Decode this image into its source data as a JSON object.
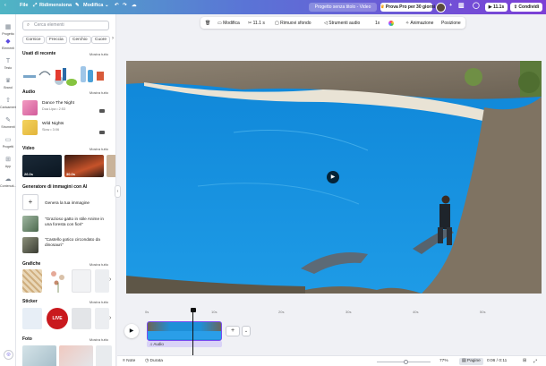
{
  "topbar": {
    "file": "File",
    "resize": "Ridimensiona",
    "edit_mode": "Modifica",
    "project_title": "Progetto senza titolo - Video",
    "trial": "Prova Pro per 30 giorni",
    "duration": "11.1s",
    "share": "Condividi"
  },
  "rail": [
    {
      "label": "Progetto",
      "icon": "layout-icon",
      "color": "#7b8591"
    },
    {
      "label": "Elementi",
      "icon": "shapes-icon",
      "color": "#5b4be0"
    },
    {
      "label": "Testo",
      "icon": "text-icon",
      "color": "#7b8591"
    },
    {
      "label": "Brand",
      "icon": "crown-icon",
      "color": "#7b8591"
    },
    {
      "label": "Caricamenti",
      "icon": "upload-icon",
      "color": "#7b8591"
    },
    {
      "label": "Strumenti",
      "icon": "tools-icon",
      "color": "#7b8591"
    },
    {
      "label": "Progetti",
      "icon": "folder-icon",
      "color": "#7b8591"
    },
    {
      "label": "App",
      "icon": "apps-icon",
      "color": "#7b8591"
    },
    {
      "label": "Contenuti...",
      "icon": "cloud-icon",
      "color": "#7b8591"
    }
  ],
  "panel": {
    "search_placeholder": "Cerca elementi",
    "chips": [
      "Cornice",
      "Freccia",
      "Cerchio",
      "Cuore"
    ],
    "recent": {
      "title": "Usati di recente",
      "link": "Mostra tutto"
    },
    "audio": {
      "title": "Audio",
      "link": "Mostra tutto",
      "tracks": [
        {
          "title": "Dance The Night",
          "artist": "Dua Lipa • 2:53",
          "badge": "■■"
        },
        {
          "title": "Wild Nights",
          "artist": "Slow • 3:06",
          "badge": "■■"
        }
      ]
    },
    "video": {
      "title": "Video",
      "link": "Mostra tutto",
      "durations": [
        "26.0s",
        "30.0s"
      ]
    },
    "ai": {
      "title": "Generatore di immagini con AI",
      "items": [
        "Genera la tua immagine",
        "\"Grazioso gatto in stile Anime in una foresta con fiori\"",
        "\"Castello gotico circondato da dinosauri\""
      ]
    },
    "graphics": {
      "title": "Grafiche",
      "link": "Mostra tutto"
    },
    "stickers": {
      "title": "Sticker",
      "link": "Mostra tutto",
      "live_label": "LIVE"
    },
    "photos": {
      "title": "Foto",
      "link": "Mostra tutto"
    }
  },
  "context_toolbar": {
    "edit": "Modifica",
    "time": "11.1 s",
    "remove_bg": "Rimuovi sfondo",
    "audio_tools": "Strumenti audio",
    "speed": "1x",
    "animate": "Animazione",
    "position": "Posizione"
  },
  "timeline": {
    "ruler": [
      "0s",
      "10s",
      "20s",
      "30s",
      "40s",
      "50s"
    ],
    "audio_label": "Audio"
  },
  "status": {
    "notes": "Note",
    "duration": "Durata",
    "zoom": "77%",
    "pages": "Pagine",
    "time": "0:06 / 0:11"
  }
}
